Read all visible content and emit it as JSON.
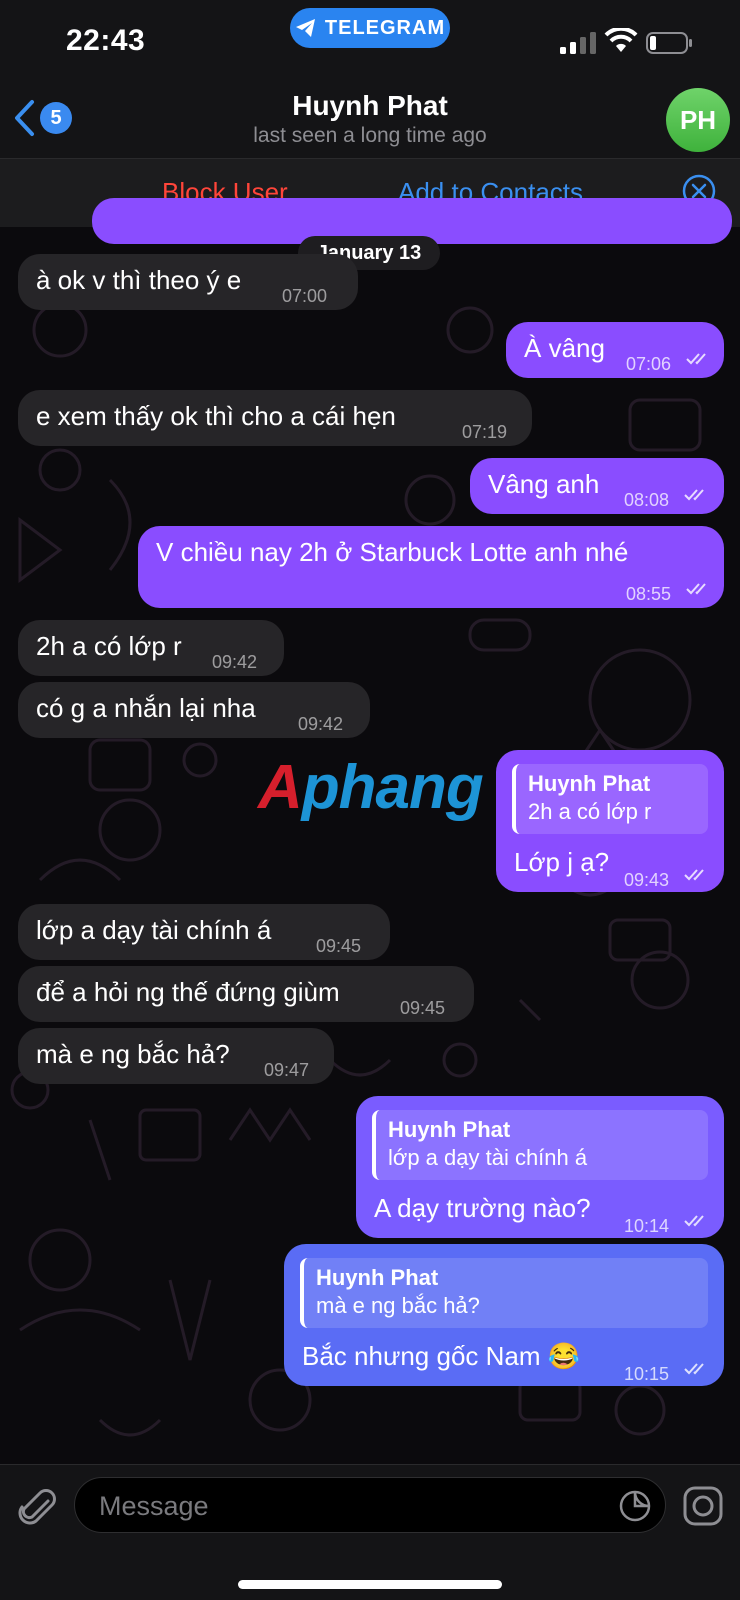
{
  "status": {
    "time": "22:43",
    "pill_label": "TELEGRAM"
  },
  "header": {
    "back_count": "5",
    "name": "Huynh Phat",
    "last_seen": "last seen a long time ago",
    "avatar_initials": "PH"
  },
  "actions": {
    "block": "Block User",
    "add": "Add to Contacts"
  },
  "date_separator": "January 13",
  "messages": [
    {
      "dir": "in",
      "text": "à ok v thì theo ý e",
      "time": "07:00"
    },
    {
      "dir": "out",
      "text": "À vâng",
      "time": "07:06"
    },
    {
      "dir": "in",
      "text": "e xem thấy ok thì cho a cái hẹn",
      "time": "07:19"
    },
    {
      "dir": "out",
      "text": "Vâng anh",
      "time": "08:08"
    },
    {
      "dir": "out",
      "text": "V chiều nay 2h ở Starbuck Lotte anh nhé",
      "time": "08:55"
    },
    {
      "dir": "in",
      "text": "2h a có lớp r",
      "time": "09:42"
    },
    {
      "dir": "in",
      "text": "có g a nhắn lại nha",
      "time": "09:42"
    },
    {
      "dir": "out",
      "reply_name": "Huynh Phat",
      "reply_text": "2h a có lớp r",
      "text": "Lớp j ạ?",
      "time": "09:43"
    },
    {
      "dir": "in",
      "text": "lớp a dạy tài chính á",
      "time": "09:45"
    },
    {
      "dir": "in",
      "text": "để a hỏi ng thế đứng giùm",
      "time": "09:45"
    },
    {
      "dir": "in",
      "text": "mà e ng bắc hả?",
      "time": "09:47"
    },
    {
      "dir": "out",
      "reply_name": "Huynh Phat",
      "reply_text": "lớp a dạy tài chính á",
      "text": "A dạy trường nào?",
      "time": "10:14"
    },
    {
      "dir": "out",
      "reply_name": "Huynh Phat",
      "reply_text": "mà e ng bắc hả?",
      "text": "Bắc nhưng gốc Nam 😂",
      "time": "10:15"
    }
  ],
  "watermark": {
    "first": "A",
    "rest": "phang"
  },
  "composer": {
    "placeholder": "Message"
  },
  "colors": {
    "outgoing": "#8a4dff",
    "incoming": "#262528",
    "accent": "#3a8ff0",
    "danger": "#ff453a"
  },
  "icons": [
    "telegram-icon",
    "signal-icon",
    "wifi-icon",
    "battery-icon",
    "back-chevron-icon",
    "close-icon",
    "paperclip-icon",
    "sticker-icon",
    "camera-icon",
    "double-check-icon"
  ]
}
